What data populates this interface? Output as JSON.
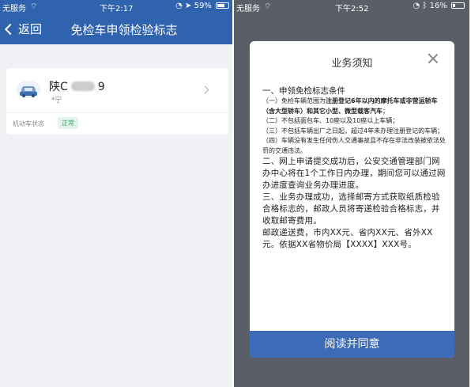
{
  "left": {
    "status": {
      "carrier": "无服务",
      "time": "下午2:17",
      "battery": "59%"
    },
    "nav": {
      "back_label": "返回",
      "title": "免检车申领检验标志"
    },
    "vehicle": {
      "plate_prefix": "陕C",
      "plate_suffix": "9",
      "owner": "*宁",
      "status_label": "机动车状态",
      "status_value": "正常"
    }
  },
  "right": {
    "status": {
      "carrier": "无服务",
      "time": "下午2:52",
      "battery": "16%"
    },
    "modal": {
      "title": "业务须知",
      "s1_heading": "一、申领免检标志条件",
      "s1_item1_a": "（一）免检车辆范围为",
      "s1_item1_b": "注册登记6年以内的摩托车或非营运轿车（含大型轿车）和其它小型、微型载客汽车",
      "s1_item1_c": "；",
      "s1_item2": "（二）不包括面包车、10座以及10座以上车辆；",
      "s1_item3": "（三）不包括车辆出厂之日起，超过4年未办理注册登记的车辆；",
      "s1_item4": "（四）车辆没有发生任何伤人交通事故且不存在非法改装被依法处罚的交通违法。",
      "s2": "二、网上申请提交成功后，公安交通管理部门网办中心将在1个工作日内办理，期间您可以通过网办进度查询业务办理进度。",
      "s3": "三、业务办理成功，选择邮寄方式获取纸质检验合格标志的，邮政人员将寄递检验合格标志，并收取邮寄费用。",
      "s4": "邮政递送费，市内XX元、省内XX元、省外XX元。依据XX省物价局【XXXX】XXX号。",
      "agree_label": "阅读并同意"
    }
  }
}
